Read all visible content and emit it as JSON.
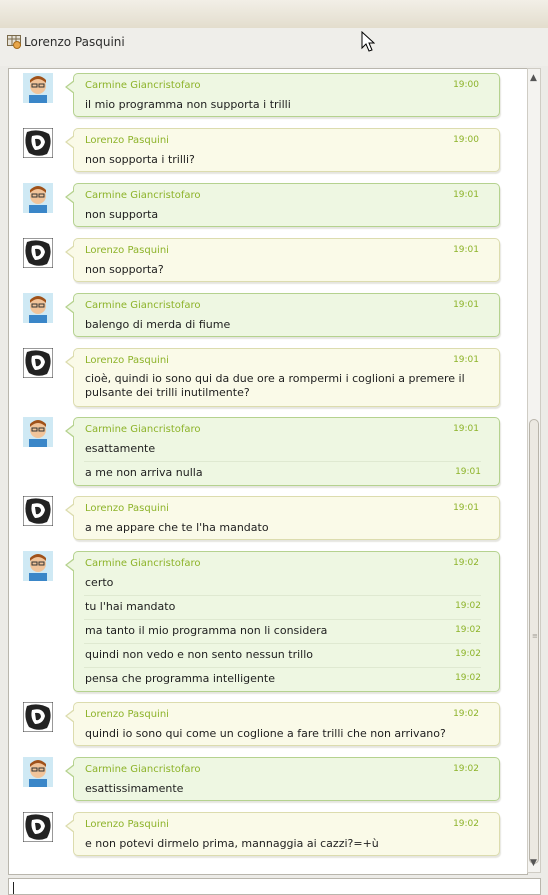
{
  "window": {
    "contact_name": "Lorenzo Pasquini"
  },
  "colors": {
    "accent": "#8db32a",
    "green_bubble": "#eef7e2",
    "yellow_bubble": "#fafae8"
  },
  "messages": [
    {
      "sender": "Carmine Giancristofaro",
      "time": "19:00",
      "lines": [
        {
          "text": "il mio programma non supporta i trilli"
        }
      ]
    },
    {
      "sender": "Lorenzo Pasquini",
      "time": "19:00",
      "lines": [
        {
          "text": "non sopporta i trilli?"
        }
      ]
    },
    {
      "sender": "Carmine Giancristofaro",
      "time": "19:01",
      "lines": [
        {
          "text": "non supporta"
        }
      ]
    },
    {
      "sender": "Lorenzo Pasquini",
      "time": "19:01",
      "lines": [
        {
          "text": "non sopporta?"
        }
      ]
    },
    {
      "sender": "Carmine Giancristofaro",
      "time": "19:01",
      "lines": [
        {
          "text": "balengo di merda di fiume"
        }
      ]
    },
    {
      "sender": "Lorenzo Pasquini",
      "time": "19:01",
      "lines": [
        {
          "text": "cioè, quindi io sono qui da due ore a rompermi i coglioni a premere il pulsante dei trilli inutilmente?"
        }
      ]
    },
    {
      "sender": "Carmine Giancristofaro",
      "time": "19:01",
      "lines": [
        {
          "text": "esattamente"
        },
        {
          "text": "a me non arriva nulla",
          "time": "19:01"
        }
      ]
    },
    {
      "sender": "Lorenzo Pasquini",
      "time": "19:01",
      "lines": [
        {
          "text": "a me appare che te l'ha mandato"
        }
      ]
    },
    {
      "sender": "Carmine Giancristofaro",
      "time": "19:02",
      "lines": [
        {
          "text": "certo"
        },
        {
          "text": "tu l'hai mandato",
          "time": "19:02"
        },
        {
          "text": "ma tanto il mio programma non li considera",
          "time": "19:02"
        },
        {
          "text": "quindi non vedo e non sento nessun trillo",
          "time": "19:02"
        },
        {
          "text": "pensa che programma intelligente",
          "time": "19:02"
        }
      ]
    },
    {
      "sender": "Lorenzo Pasquini",
      "time": "19:02",
      "lines": [
        {
          "text": "quindi io sono qui come un coglione a fare trilli che non arrivano?"
        }
      ]
    },
    {
      "sender": "Carmine Giancristofaro",
      "time": "19:02",
      "lines": [
        {
          "text": "esattissimamente"
        }
      ]
    },
    {
      "sender": "Lorenzo Pasquini",
      "time": "19:02",
      "lines": [
        {
          "text": "e non potevi dirmelo prima, mannaggia ai cazzi?=+ù"
        }
      ]
    }
  ],
  "input": {
    "value": ""
  }
}
